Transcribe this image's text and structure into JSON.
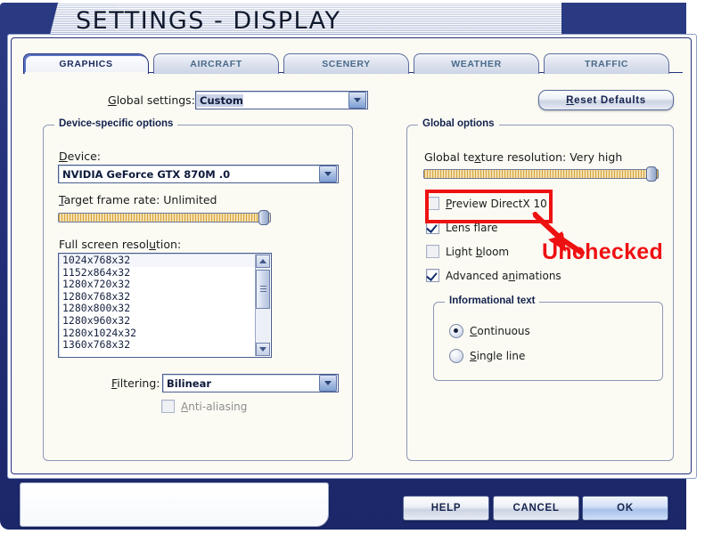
{
  "window": {
    "title": "SETTINGS - DISPLAY"
  },
  "tabs": [
    {
      "label": "GRAPHICS",
      "active": true
    },
    {
      "label": "AIRCRAFT",
      "active": false
    },
    {
      "label": "SCENERY",
      "active": false
    },
    {
      "label": "WEATHER",
      "active": false
    },
    {
      "label": "TRAFFIC",
      "active": false
    }
  ],
  "top": {
    "global_settings_label": "Global settings:",
    "global_settings_value": "Custom",
    "reset_defaults_label": "Reset Defaults"
  },
  "device_group": {
    "title": "Device-specific options",
    "device_label": "Device:",
    "device_value": "NVIDIA GeForce GTX 870M .0",
    "frame_rate_label": "Target frame rate: Unlimited",
    "frame_rate_percent": 97,
    "resolution_label": "Full screen resolution:",
    "resolutions": [
      "1024x768x32",
      "1152x864x32",
      "1280x720x32",
      "1280x768x32",
      "1280x800x32",
      "1280x960x32",
      "1280x1024x32",
      "1360x768x32"
    ],
    "resolution_selected_index": 0,
    "filtering_label": "Filtering:",
    "filtering_value": "Bilinear",
    "antialiasing_label": "Anti-aliasing",
    "antialiasing_checked": false
  },
  "global_group": {
    "title": "Global options",
    "texture_label": "Global texture resolution: Very high",
    "texture_percent": 97,
    "checkboxes": [
      {
        "label": "Preview DirectX 10",
        "checked": false
      },
      {
        "label": "Lens flare",
        "checked": true
      },
      {
        "label": "Light bloom",
        "checked": false
      },
      {
        "label": "Advanced animations",
        "checked": true
      }
    ],
    "info_group_title": "Informational text",
    "info_options": [
      {
        "label": "Continuous",
        "selected": true
      },
      {
        "label": "Single line",
        "selected": false
      }
    ]
  },
  "footer": {
    "help_label": "HELP",
    "cancel_label": "CANCEL",
    "ok_label": "OK"
  },
  "annotation": {
    "text": "Unchecked",
    "color": "#ee1111"
  }
}
